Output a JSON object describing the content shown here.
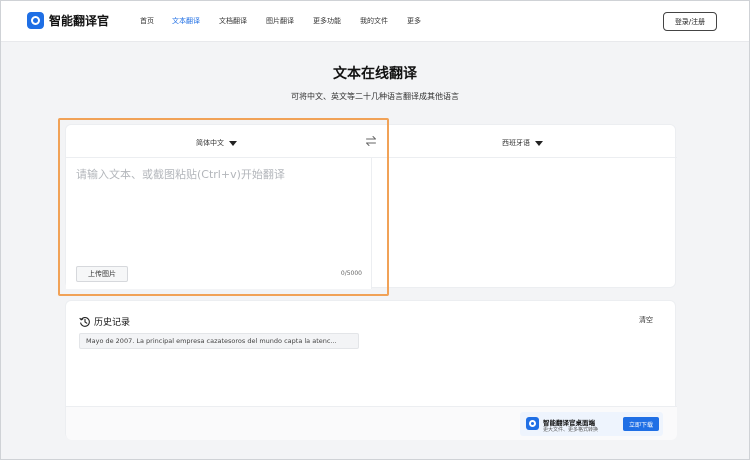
{
  "header": {
    "logo_text": "智能翻译官",
    "nav": [
      {
        "label": "首页"
      },
      {
        "label": "文本翻译"
      },
      {
        "label": "文档翻译"
      },
      {
        "label": "图片翻译"
      },
      {
        "label": "更多功能"
      },
      {
        "label": "我的文件"
      },
      {
        "label": "更多"
      }
    ],
    "active_nav": "文本翻译",
    "login_label": "登录/注册"
  },
  "hero": {
    "title": "文本在线翻译",
    "subtitle": "可将中文、英文等二十几种语言翻译成其他语言"
  },
  "translator": {
    "source_lang": "简体中文",
    "target_lang": "西班牙语",
    "input_placeholder": "请输入文本、或截图粘贴(Ctrl+v)开始翻译",
    "input_value": "",
    "upload_label": "上传图片",
    "char_count": "0/5000"
  },
  "history": {
    "title": "历史记录",
    "clear_label": "清空",
    "items": [
      {
        "text": "Mayo de 2007. La principal empresa cazatesoros del mundo capta la atenc..."
      }
    ]
  },
  "promo": {
    "title": "智能翻译官桌面端",
    "subtitle": "更大文件、更多格式转换",
    "button_label": "立即下载"
  },
  "colors": {
    "accent": "#1f6fe5",
    "highlight": "#f1a257",
    "background": "#f3f4f6"
  }
}
